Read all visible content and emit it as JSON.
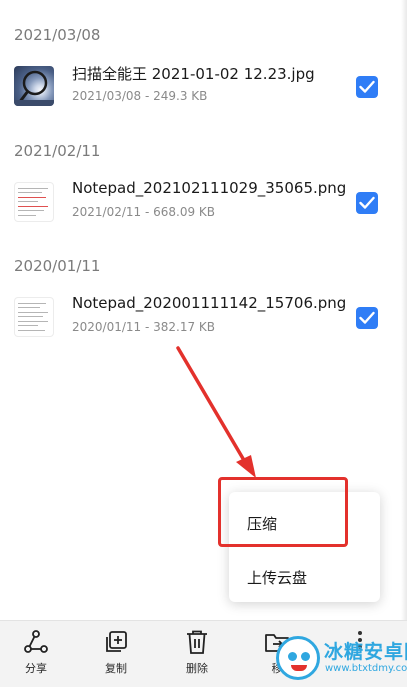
{
  "file_groups": [
    {
      "date": "2021/03/08",
      "files": [
        {
          "name": "扫描全能王 2021-01-02 12.23.jpg",
          "meta": "2021/03/08 - 249.3 KB",
          "thumb_icon": "photo-thumbnail",
          "checked": true
        }
      ]
    },
    {
      "date": "2021/02/11",
      "files": [
        {
          "name": "Notepad_202102111029_35065.png",
          "meta": "2021/02/11 - 668.09 KB",
          "thumb_icon": "document-thumbnail",
          "checked": true
        }
      ]
    },
    {
      "date": "2020/01/11",
      "files": [
        {
          "name": "Notepad_202001111142_15706.png",
          "meta": "2020/01/11 - 382.17 KB",
          "thumb_icon": "document-thumbnail",
          "checked": true
        }
      ]
    }
  ],
  "popup_menu": {
    "items": [
      {
        "label": "压缩",
        "highlighted": true
      },
      {
        "label": "上传云盘",
        "highlighted": false
      }
    ]
  },
  "bottom_toolbar": {
    "items": [
      {
        "label": "分享",
        "icon": "share-icon"
      },
      {
        "label": "复制",
        "icon": "copy-icon"
      },
      {
        "label": "删除",
        "icon": "trash-icon"
      },
      {
        "label": "移",
        "icon": "move-folder-icon"
      },
      {
        "label": "",
        "icon": "more-icon"
      }
    ]
  },
  "watermark": {
    "title": "冰糖安卓网",
    "url": "www.btxtdmy.com"
  },
  "colors": {
    "accent": "#2f7df6",
    "highlight_red": "#e3312c",
    "watermark_blue": "#2fa7e0",
    "toolbar_bg": "#f3f3f3"
  }
}
